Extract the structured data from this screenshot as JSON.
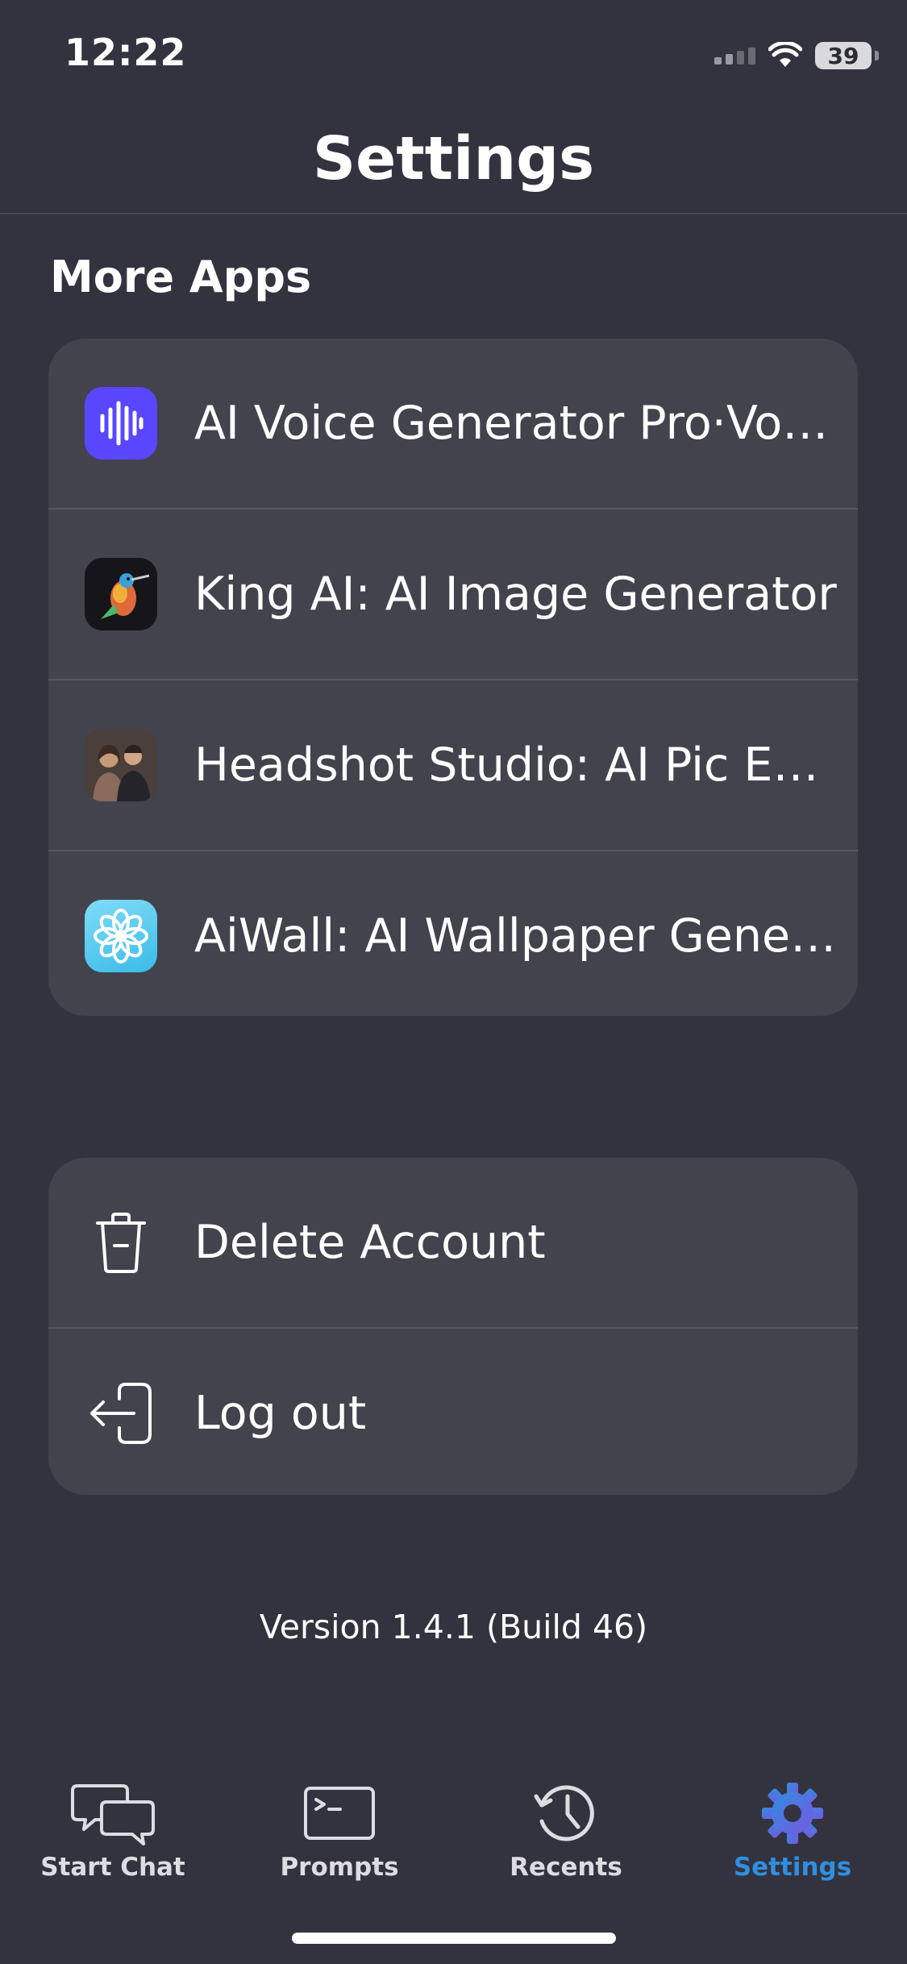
{
  "status_bar": {
    "time": "12:22",
    "battery": "39"
  },
  "header": {
    "title": "Settings"
  },
  "more_apps": {
    "section_title": "More Apps",
    "items": [
      {
        "label": "AI Voice Generator Pro·Voi…",
        "icon": "voice-generator-app-icon"
      },
      {
        "label": "King AI: AI Image Generator",
        "icon": "hummingbird-app-icon"
      },
      {
        "label": "Headshot Studio: AI Pic Ed…",
        "icon": "headshot-portrait-app-icon"
      },
      {
        "label": "AiWall: AI Wallpaper Gener…",
        "icon": "flower-app-icon"
      }
    ]
  },
  "account": {
    "items": [
      {
        "label": "Delete Account",
        "icon": "trash-icon"
      },
      {
        "label": "Log out",
        "icon": "logout-icon"
      }
    ]
  },
  "version": "Version 1.4.1 (Build 46)",
  "tab_bar": {
    "tabs": [
      {
        "label": "Start Chat",
        "icon": "chat-bubbles-icon"
      },
      {
        "label": "Prompts",
        "icon": "terminal-icon"
      },
      {
        "label": "Recents",
        "icon": "history-icon"
      },
      {
        "label": "Settings",
        "icon": "gear-icon",
        "active": true
      }
    ]
  },
  "colors": {
    "background": "#33333f",
    "card": "#43434e",
    "accent": "#2f8ee0",
    "voice_icon": "#5a46ff"
  }
}
